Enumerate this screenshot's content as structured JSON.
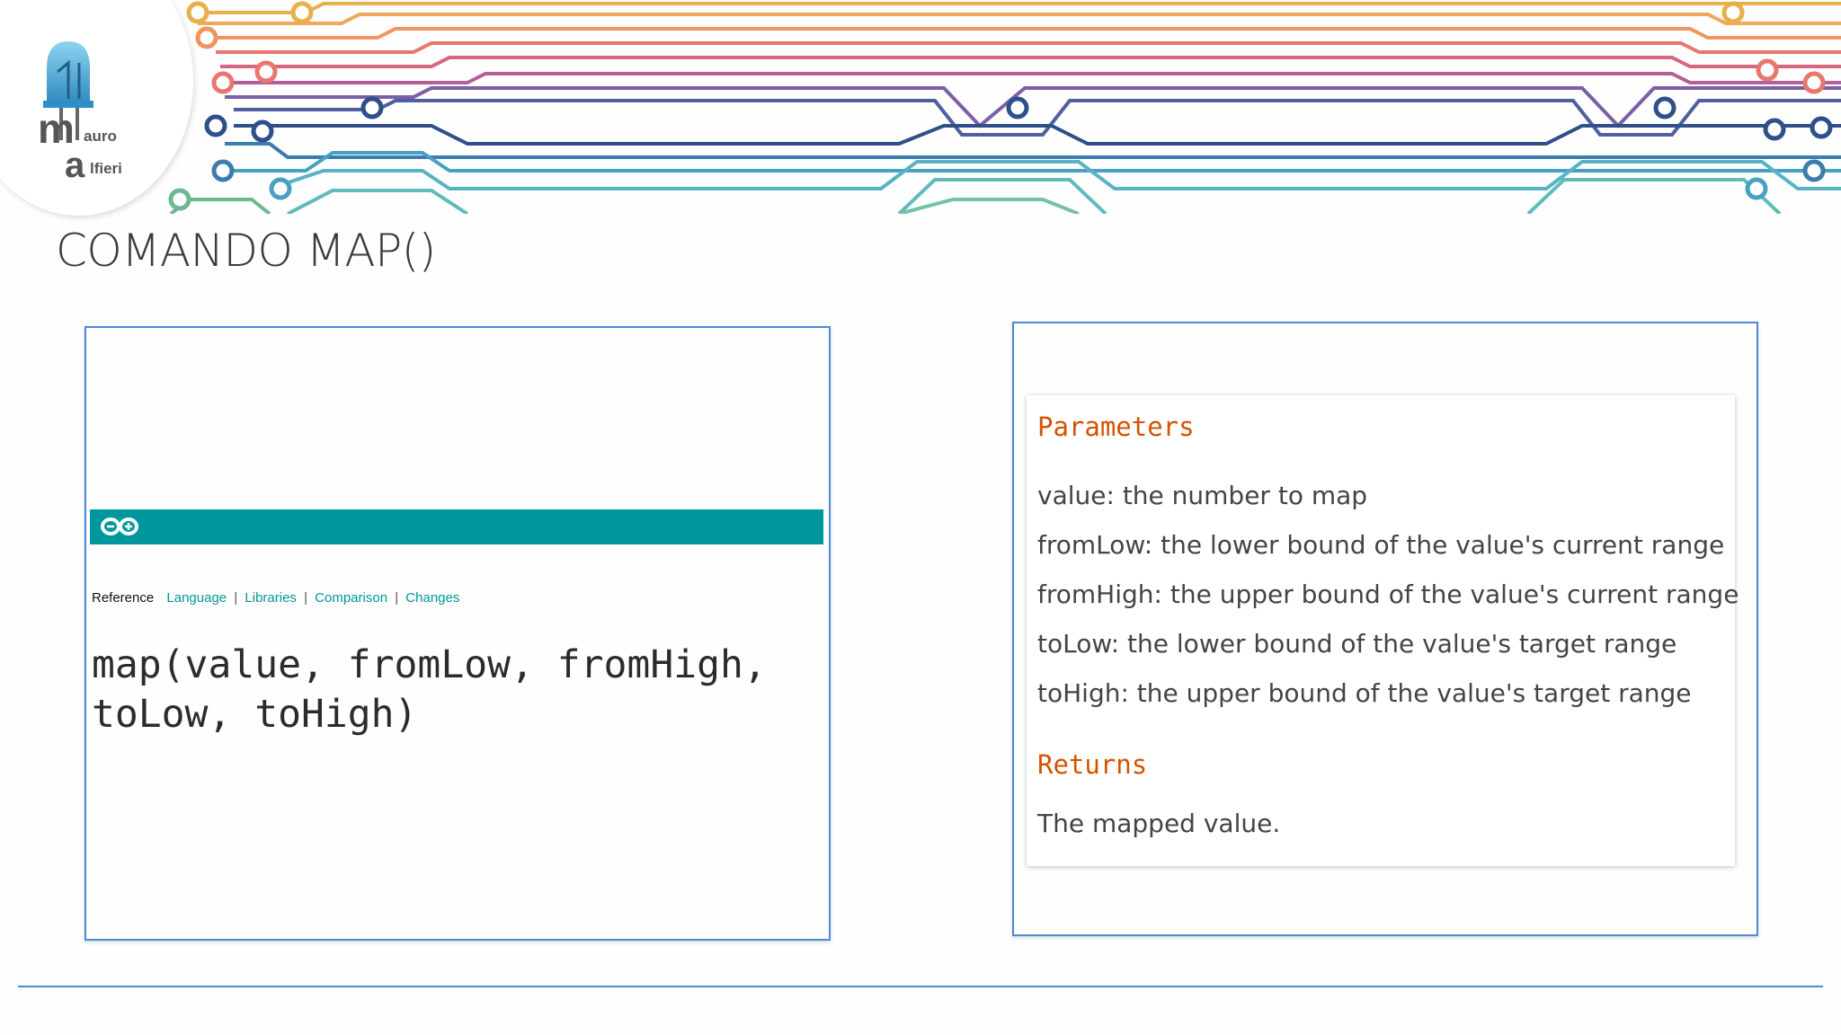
{
  "logo": {
    "m": "m",
    "auro": "auro",
    "a": "a",
    "lfieri": "lfieri"
  },
  "slide": {
    "title": "COMANDO MAP()"
  },
  "reference_page": {
    "nav_label": "Reference",
    "nav_links": [
      "Language",
      "Libraries",
      "Comparison",
      "Changes"
    ],
    "signature": "map(value, fromLow, fromHigh,\ntoLow, toHigh)",
    "brand_color": "#00979c"
  },
  "docs": {
    "parameters_heading": "Parameters",
    "parameters": [
      "value: the number to map",
      "fromLow: the lower bound of the value's current range",
      "fromHigh: the upper bound of the value's current range",
      "toLow: the lower bound of the value's target range",
      "toHigh: the upper bound of the value's target range"
    ],
    "returns_heading": "Returns",
    "returns_text": "The mapped value.",
    "heading_color": "#d35400"
  },
  "theme": {
    "panel_border": "#4a8ad8"
  }
}
